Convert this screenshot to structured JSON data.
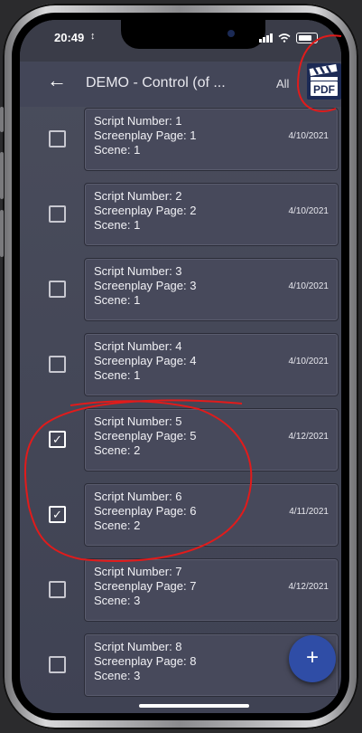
{
  "status": {
    "time": "20:49"
  },
  "appbar": {
    "back": "←",
    "title": "DEMO - Control (of ...",
    "all_label": "All",
    "pdf_label": "PDF"
  },
  "rows": [
    {
      "line1": "Script Number: 1",
      "line2": "Screenplay Page: 1",
      "line3": "Scene: 1",
      "date": "4/10/2021",
      "checked": false
    },
    {
      "line1": "Script Number: 2",
      "line2": "Screenplay Page: 2",
      "line3": "Scene: 1",
      "date": "4/10/2021",
      "checked": false
    },
    {
      "line1": "Script Number: 3",
      "line2": "Screenplay Page: 3",
      "line3": "Scene: 1",
      "date": "4/10/2021",
      "checked": false
    },
    {
      "line1": "Script Number: 4",
      "line2": "Screenplay Page: 4",
      "line3": "Scene: 1",
      "date": "4/10/2021",
      "checked": false
    },
    {
      "line1": "Script Number: 5",
      "line2": "Screenplay Page: 5",
      "line3": "Scene: 2",
      "date": "4/12/2021",
      "checked": true
    },
    {
      "line1": "Script Number: 6",
      "line2": "Screenplay Page: 6",
      "line3": "Scene: 2",
      "date": "4/11/2021",
      "checked": true
    },
    {
      "line1": "Script Number: 7",
      "line2": "Screenplay Page: 7",
      "line3": "Scene: 3",
      "date": "4/12/2021",
      "checked": false
    },
    {
      "line1": "Script Number: 8",
      "line2": "Screenplay Page: 8",
      "line3": "Scene: 3",
      "date": "4/1",
      "checked": false
    }
  ],
  "fab": {
    "label": "+"
  },
  "colors": {
    "accent": "#2f4da6",
    "annotation": "#e11b1b"
  }
}
